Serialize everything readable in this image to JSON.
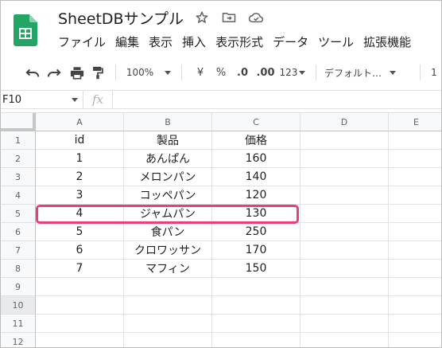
{
  "app": {
    "title": "SheetDBサンプル",
    "menu": [
      "ファイル",
      "編集",
      "表示",
      "挿入",
      "表示形式",
      "データ",
      "ツール",
      "拡張機能"
    ]
  },
  "toolbar": {
    "zoom": "100%",
    "currency": "¥",
    "percent": "%",
    "dec_decrease": ".0",
    "dec_increase": ".00",
    "number_format": "123",
    "font": "デフォルト…",
    "font_size": "1"
  },
  "formula_bar": {
    "cell_ref": "F10",
    "fx": "fx",
    "value": ""
  },
  "grid": {
    "columns": [
      "A",
      "B",
      "C",
      "D",
      "E"
    ],
    "row_numbers": [
      "1",
      "2",
      "3",
      "4",
      "5",
      "6",
      "7",
      "8",
      "9",
      "10",
      "11",
      "12"
    ],
    "rows": [
      [
        "id",
        "製品",
        "価格"
      ],
      [
        "1",
        "あんぱん",
        "160"
      ],
      [
        "2",
        "メロンパン",
        "140"
      ],
      [
        "3",
        "コッペパン",
        "120"
      ],
      [
        "4",
        "ジャムパン",
        "130"
      ],
      [
        "5",
        "食パン",
        "250"
      ],
      [
        "6",
        "クロワッサン",
        "170"
      ],
      [
        "7",
        "マフィン",
        "150"
      ]
    ],
    "highlighted_row_number": "5"
  },
  "colors": {
    "accent": "#e83e7a",
    "logo": "#23a566"
  }
}
